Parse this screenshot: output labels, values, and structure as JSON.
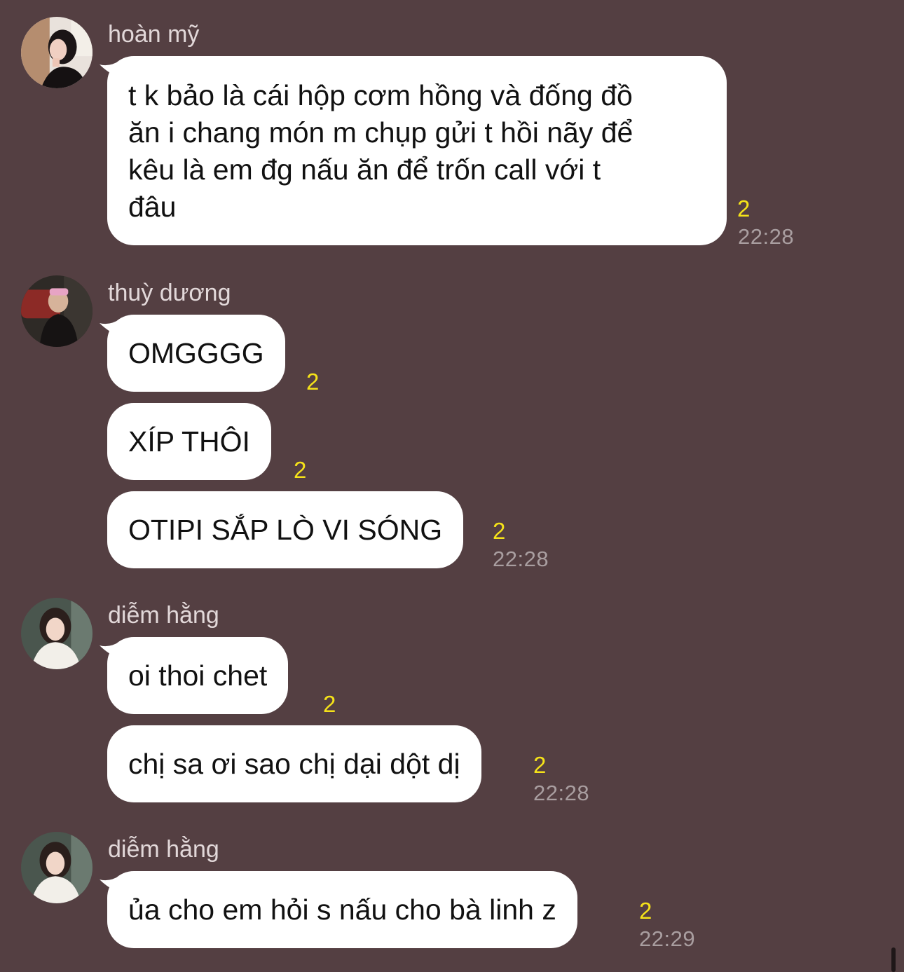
{
  "groups": [
    {
      "sender": "hoàn mỹ",
      "messages": [
        {
          "lines": [
            "t k bảo là cái hộp cơm hồng và đống đồ",
            "ăn i chang món m chụp gửi t hồi nãy để",
            "kêu là em đg nấu ăn để trốn call với t",
            "đâu"
          ],
          "unread": "2"
        }
      ],
      "time": "22:28"
    },
    {
      "sender": "thuỳ dương",
      "messages": [
        {
          "text": "OMGGGG",
          "unread": "2"
        },
        {
          "text": "XÍP THÔI",
          "unread": "2"
        },
        {
          "text": "OTIPI SẮP LÒ VI SÓNG",
          "unread": "2"
        }
      ],
      "time": "22:28"
    },
    {
      "sender": "diễm hằng",
      "messages": [
        {
          "text": "oi thoi chet",
          "unread": "2"
        },
        {
          "text": "chị sa ơi sao chị dại dột dị",
          "unread": "2"
        }
      ],
      "time": "22:28"
    },
    {
      "sender": "diễm hằng",
      "messages": [
        {
          "text": "ủa cho em hỏi s nấu cho bà linh z",
          "unread": "2"
        }
      ],
      "time": "22:29"
    }
  ]
}
